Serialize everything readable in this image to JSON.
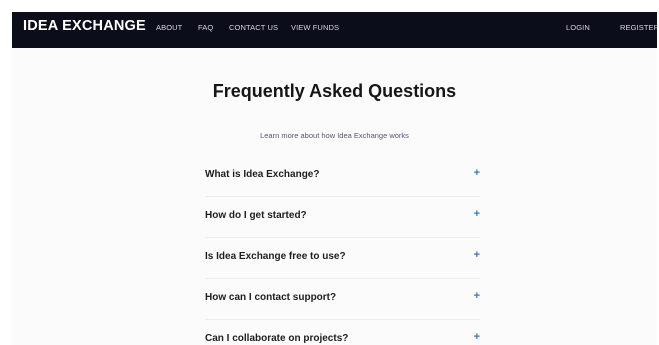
{
  "navbar": {
    "brand": "IDEA EXCHANGE",
    "links": [
      "ABOUT",
      "FAQ",
      "CONTACT US",
      "VIEW FUNDS"
    ],
    "right_links": [
      "LOGIN",
      "REGISTER"
    ]
  },
  "main": {
    "title": "Frequently Asked Questions",
    "subtitle": "Learn more about how Idea Exchange works",
    "faq": [
      {
        "question": "What is Idea Exchange?",
        "toggle": "+"
      },
      {
        "question": "How do I get started?",
        "toggle": "+"
      },
      {
        "question": "Is Idea Exchange free to use?",
        "toggle": "+"
      },
      {
        "question": "How can I contact support?",
        "toggle": "+"
      },
      {
        "question": "Can I collaborate on projects?",
        "toggle": "+"
      }
    ]
  },
  "colors": {
    "navbar_bg": "#0b0d1a",
    "accent": "#3a76c9",
    "page_bg": "#fbfbfb"
  }
}
